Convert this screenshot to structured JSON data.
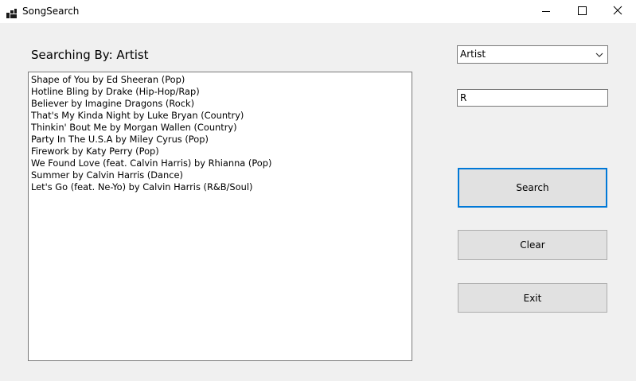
{
  "window": {
    "title": "SongSearch"
  },
  "search_label": "Searching By: Artist",
  "results": [
    "Shape of You by Ed Sheeran (Pop)",
    "Hotline Bling by Drake (Hip-Hop/Rap)",
    "Believer by Imagine Dragons (Rock)",
    "That's My Kinda Night by Luke Bryan (Country)",
    "Thinkin' Bout Me by Morgan Wallen (Country)",
    "Party In The U.S.A by Miley Cyrus (Pop)",
    "Firework by Katy Perry (Pop)",
    "We Found Love (feat. Calvin Harris) by Rhianna (Pop)",
    "Summer by Calvin Harris (Dance)",
    "Let's Go (feat. Ne-Yo) by Calvin Harris (R&B/Soul)"
  ],
  "search_by_combo": {
    "selected": "Artist"
  },
  "search_input": {
    "value": "R"
  },
  "buttons": {
    "search": "Search",
    "clear": "Clear",
    "exit": "Exit"
  },
  "colors": {
    "focus_border": "#0078d7",
    "button_bg": "#e1e1e1",
    "window_bg": "#f0f0f0"
  },
  "icons": {
    "app": "app-icon",
    "minimize": "minimize-icon",
    "maximize": "maximize-icon",
    "close": "close-icon",
    "dropdown": "chevron-down-icon"
  }
}
